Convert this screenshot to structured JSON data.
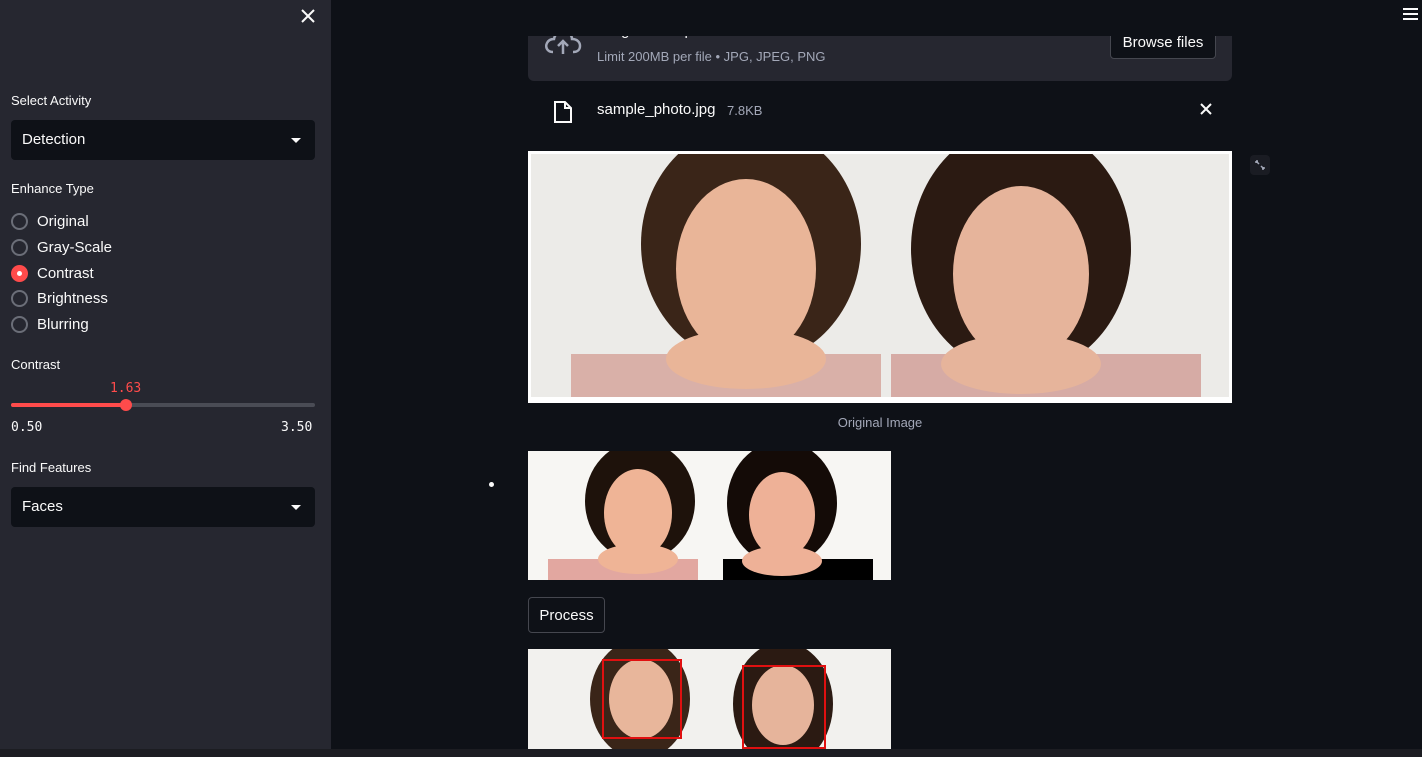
{
  "sidebar": {
    "select_activity_label": "Select Activity",
    "activity_value": "Detection",
    "enhance_type_label": "Enhance Type",
    "enhance_options": [
      "Original",
      "Gray-Scale",
      "Contrast",
      "Brightness",
      "Blurring"
    ],
    "enhance_selected": "Contrast",
    "contrast_label": "Contrast",
    "contrast_value": "1.63",
    "contrast_min": "0.50",
    "contrast_max": "3.50",
    "contrast_fraction": 0.377,
    "find_features_label": "Find Features",
    "features_value": "Faces"
  },
  "uploader": {
    "drag_text": "Drag and drop file here",
    "limit_text": "Limit 200MB per file • JPG, JPEG, PNG",
    "browse_label": "Browse files"
  },
  "file": {
    "name": "sample_photo.jpg",
    "size": "7.8KB"
  },
  "main": {
    "caption": "Original Image",
    "process_label": "Process"
  },
  "colors": {
    "accent": "#ff4b4b",
    "background": "#0e1117",
    "sidebar": "#262730",
    "box": "#e01010"
  }
}
